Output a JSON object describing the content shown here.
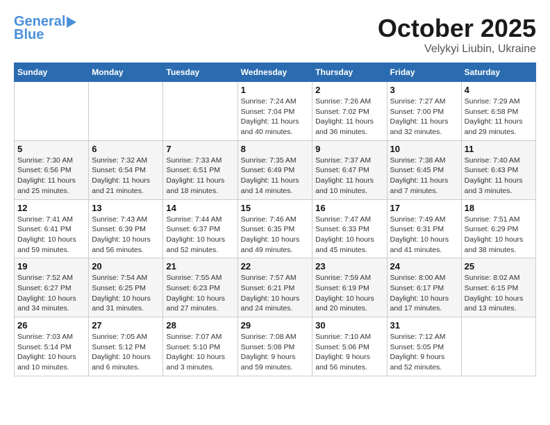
{
  "header": {
    "logo_line1": "General",
    "logo_line2": "Blue",
    "month": "October 2025",
    "location": "Velykyi Liubin, Ukraine"
  },
  "weekdays": [
    "Sunday",
    "Monday",
    "Tuesday",
    "Wednesday",
    "Thursday",
    "Friday",
    "Saturday"
  ],
  "weeks": [
    [
      {
        "day": "",
        "info": ""
      },
      {
        "day": "",
        "info": ""
      },
      {
        "day": "",
        "info": ""
      },
      {
        "day": "1",
        "info": "Sunrise: 7:24 AM\nSunset: 7:04 PM\nDaylight: 11 hours\nand 40 minutes."
      },
      {
        "day": "2",
        "info": "Sunrise: 7:26 AM\nSunset: 7:02 PM\nDaylight: 11 hours\nand 36 minutes."
      },
      {
        "day": "3",
        "info": "Sunrise: 7:27 AM\nSunset: 7:00 PM\nDaylight: 11 hours\nand 32 minutes."
      },
      {
        "day": "4",
        "info": "Sunrise: 7:29 AM\nSunset: 6:58 PM\nDaylight: 11 hours\nand 29 minutes."
      }
    ],
    [
      {
        "day": "5",
        "info": "Sunrise: 7:30 AM\nSunset: 6:56 PM\nDaylight: 11 hours\nand 25 minutes."
      },
      {
        "day": "6",
        "info": "Sunrise: 7:32 AM\nSunset: 6:54 PM\nDaylight: 11 hours\nand 21 minutes."
      },
      {
        "day": "7",
        "info": "Sunrise: 7:33 AM\nSunset: 6:51 PM\nDaylight: 11 hours\nand 18 minutes."
      },
      {
        "day": "8",
        "info": "Sunrise: 7:35 AM\nSunset: 6:49 PM\nDaylight: 11 hours\nand 14 minutes."
      },
      {
        "day": "9",
        "info": "Sunrise: 7:37 AM\nSunset: 6:47 PM\nDaylight: 11 hours\nand 10 minutes."
      },
      {
        "day": "10",
        "info": "Sunrise: 7:38 AM\nSunset: 6:45 PM\nDaylight: 11 hours\nand 7 minutes."
      },
      {
        "day": "11",
        "info": "Sunrise: 7:40 AM\nSunset: 6:43 PM\nDaylight: 11 hours\nand 3 minutes."
      }
    ],
    [
      {
        "day": "12",
        "info": "Sunrise: 7:41 AM\nSunset: 6:41 PM\nDaylight: 10 hours\nand 59 minutes."
      },
      {
        "day": "13",
        "info": "Sunrise: 7:43 AM\nSunset: 6:39 PM\nDaylight: 10 hours\nand 56 minutes."
      },
      {
        "day": "14",
        "info": "Sunrise: 7:44 AM\nSunset: 6:37 PM\nDaylight: 10 hours\nand 52 minutes."
      },
      {
        "day": "15",
        "info": "Sunrise: 7:46 AM\nSunset: 6:35 PM\nDaylight: 10 hours\nand 49 minutes."
      },
      {
        "day": "16",
        "info": "Sunrise: 7:47 AM\nSunset: 6:33 PM\nDaylight: 10 hours\nand 45 minutes."
      },
      {
        "day": "17",
        "info": "Sunrise: 7:49 AM\nSunset: 6:31 PM\nDaylight: 10 hours\nand 41 minutes."
      },
      {
        "day": "18",
        "info": "Sunrise: 7:51 AM\nSunset: 6:29 PM\nDaylight: 10 hours\nand 38 minutes."
      }
    ],
    [
      {
        "day": "19",
        "info": "Sunrise: 7:52 AM\nSunset: 6:27 PM\nDaylight: 10 hours\nand 34 minutes."
      },
      {
        "day": "20",
        "info": "Sunrise: 7:54 AM\nSunset: 6:25 PM\nDaylight: 10 hours\nand 31 minutes."
      },
      {
        "day": "21",
        "info": "Sunrise: 7:55 AM\nSunset: 6:23 PM\nDaylight: 10 hours\nand 27 minutes."
      },
      {
        "day": "22",
        "info": "Sunrise: 7:57 AM\nSunset: 6:21 PM\nDaylight: 10 hours\nand 24 minutes."
      },
      {
        "day": "23",
        "info": "Sunrise: 7:59 AM\nSunset: 6:19 PM\nDaylight: 10 hours\nand 20 minutes."
      },
      {
        "day": "24",
        "info": "Sunrise: 8:00 AM\nSunset: 6:17 PM\nDaylight: 10 hours\nand 17 minutes."
      },
      {
        "day": "25",
        "info": "Sunrise: 8:02 AM\nSunset: 6:15 PM\nDaylight: 10 hours\nand 13 minutes."
      }
    ],
    [
      {
        "day": "26",
        "info": "Sunrise: 7:03 AM\nSunset: 5:14 PM\nDaylight: 10 hours\nand 10 minutes."
      },
      {
        "day": "27",
        "info": "Sunrise: 7:05 AM\nSunset: 5:12 PM\nDaylight: 10 hours\nand 6 minutes."
      },
      {
        "day": "28",
        "info": "Sunrise: 7:07 AM\nSunset: 5:10 PM\nDaylight: 10 hours\nand 3 minutes."
      },
      {
        "day": "29",
        "info": "Sunrise: 7:08 AM\nSunset: 5:08 PM\nDaylight: 9 hours\nand 59 minutes."
      },
      {
        "day": "30",
        "info": "Sunrise: 7:10 AM\nSunset: 5:06 PM\nDaylight: 9 hours\nand 56 minutes."
      },
      {
        "day": "31",
        "info": "Sunrise: 7:12 AM\nSunset: 5:05 PM\nDaylight: 9 hours\nand 52 minutes."
      },
      {
        "day": "",
        "info": ""
      }
    ]
  ]
}
